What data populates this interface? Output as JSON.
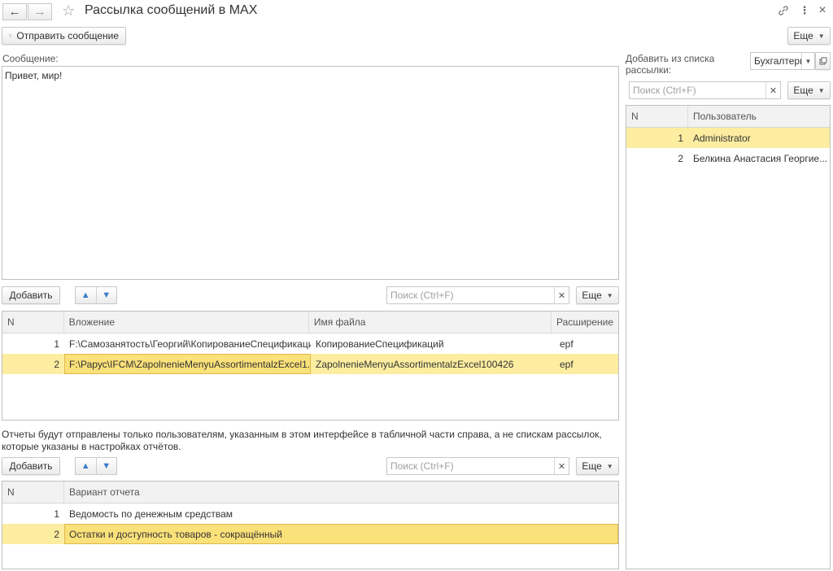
{
  "header": {
    "title": "Рассылка сообщений в MAX",
    "back": "←",
    "forward": "→",
    "star": "☆",
    "link": "🔗",
    "more": "⋮",
    "close": "×"
  },
  "toolbar": {
    "send_label": "Отправить сообщение",
    "more_label": "Еще"
  },
  "message": {
    "label": "Сообщение:",
    "text": "Привет, мир!"
  },
  "attachments": {
    "add_label": "Добавить",
    "search_placeholder": "Поиск (Ctrl+F)",
    "more_label": "Еще",
    "columns": [
      "N",
      "Вложение",
      "Имя файла",
      "Расширение"
    ],
    "rows": [
      {
        "n": "1",
        "path": "F:\\Самозанятость\\Георгий\\КопированиеСпецификаци...",
        "file": "КопированиеСпецификаций",
        "ext": "epf"
      },
      {
        "n": "2",
        "path": "F:\\Рарус\\IFCM\\ZapolnenieMenyuAssortimentalzExcel1...",
        "file": "ZapolnenieMenyuAssortimentalzExcel100426",
        "ext": "epf"
      }
    ]
  },
  "info_text": "Отчеты будут отправлены только пользователям, указанным в этом интерфейсе в табличной части справа, а не спискам рассылок, которые указаны в настройках отчётов.",
  "reports": {
    "add_label": "Добавить",
    "search_placeholder": "Поиск (Ctrl+F)",
    "more_label": "Еще",
    "columns": [
      "N",
      "Вариант отчета"
    ],
    "rows": [
      {
        "n": "1",
        "name": "Ведомость по денежным средствам"
      },
      {
        "n": "2",
        "name": "Остатки и доступность товаров - сокращённый"
      }
    ]
  },
  "users": {
    "list_label": "Добавить из списка рассылки:",
    "list_value": "Бухгалтеры",
    "search_placeholder": "Поиск (Ctrl+F)",
    "more_label": "Еще",
    "columns": [
      "N",
      "Пользователь"
    ],
    "rows": [
      {
        "n": "1",
        "name": "Administrator"
      },
      {
        "n": "2",
        "name": "Белкина Анастасия Георгие..."
      }
    ]
  }
}
